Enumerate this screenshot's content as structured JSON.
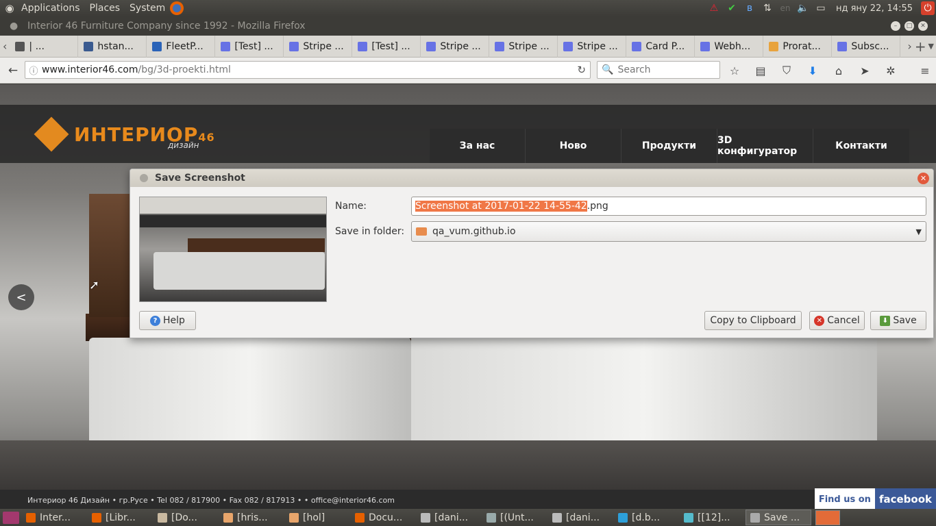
{
  "top_panel": {
    "menus": [
      "Applications",
      "Places",
      "System"
    ],
    "indicators": [
      "warning-icon",
      "check-icon",
      "bluetooth-icon",
      "network-icon",
      "en",
      "volume-icon",
      "battery-icon"
    ],
    "clock": "нд яну 22, 14:55"
  },
  "firefox": {
    "window_title": "Interior 46 Furniture Company since 1992 - Mozilla Firefox",
    "tabs": [
      {
        "label": "| ...",
        "icon_color": "#555"
      },
      {
        "label": "hstan...",
        "icon_color": "#3a5a8f"
      },
      {
        "label": "FleetP...",
        "icon_color": "#2a63b8"
      },
      {
        "label": "[Test] ...",
        "icon_color": "#6772e5"
      },
      {
        "label": "Stripe ...",
        "icon_color": "#6772e5"
      },
      {
        "label": "[Test] ...",
        "icon_color": "#6772e5"
      },
      {
        "label": "Stripe ...",
        "icon_color": "#6772e5"
      },
      {
        "label": "Stripe ...",
        "icon_color": "#6772e5"
      },
      {
        "label": "Stripe ...",
        "icon_color": "#6772e5"
      },
      {
        "label": "Card P...",
        "icon_color": "#6772e5"
      },
      {
        "label": "Webh...",
        "icon_color": "#6772e5"
      },
      {
        "label": "Prorat...",
        "icon_color": "#e8a33d"
      },
      {
        "label": "Subsc...",
        "icon_color": "#6772e5"
      }
    ],
    "url_host": "www.interior46.com",
    "url_path": "/bg/3d-proekti.html",
    "search_placeholder": "Search"
  },
  "site": {
    "logo_text": "ИНТЕРИОР",
    "logo_number": "46",
    "logo_sub": "дизайн",
    "nav": [
      "За нас",
      "Ново",
      "Продукти",
      "3D конфигуратор",
      "Контакти"
    ],
    "footer": "Интериор 46 Дизайн • гр.Русе • Tel 082 / 817900 • Fax 082 / 817913 • • office@interior46.com",
    "find_us": "Find us on",
    "facebook": "facebook",
    "prev_arrow": "<"
  },
  "dialog": {
    "title": "Save Screenshot",
    "name_label": "Name:",
    "name_selected": "Screenshot at 2017-01-22 14-55-42",
    "name_ext": ".png",
    "folder_label": "Save in folder:",
    "folder_value": "qa_vum.github.io",
    "help_button": "Help",
    "copy_button": "Copy to Clipboard",
    "cancel_button": "Cancel",
    "save_button": "Save"
  },
  "taskbar": [
    {
      "label": "Inter...",
      "color": "#e66000"
    },
    {
      "label": "[Libr...",
      "color": "#e66000"
    },
    {
      "label": "[Do...",
      "color": "#c9b9a0"
    },
    {
      "label": "[hris...",
      "color": "#e8a56b"
    },
    {
      "label": "[hol]",
      "color": "#e8a56b"
    },
    {
      "label": "Docu...",
      "color": "#e66000"
    },
    {
      "label": "[dani...",
      "color": "#bbb"
    },
    {
      "label": "[(Unt...",
      "color": "#9aa"
    },
    {
      "label": "[dani...",
      "color": "#bbb"
    },
    {
      "label": "[d.b...",
      "color": "#2d9fd9"
    },
    {
      "label": "[[12]...",
      "color": "#5bc"
    },
    {
      "label": "Save ...",
      "color": "#aaa",
      "active": true
    }
  ]
}
